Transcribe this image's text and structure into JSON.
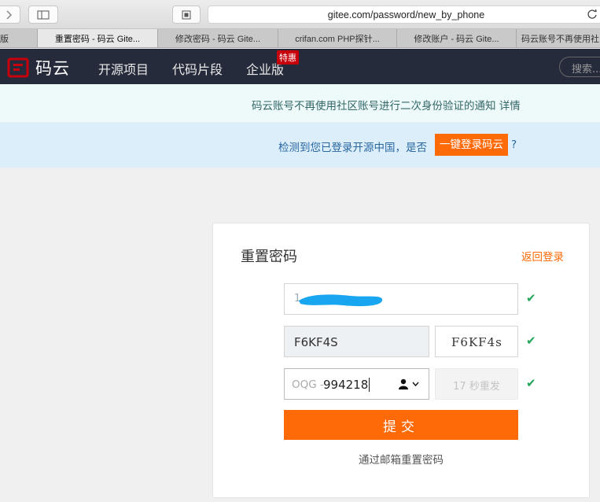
{
  "browser": {
    "url": "gitee.com/password/new_by_phone",
    "tabs": [
      {
        "label": "版"
      },
      {
        "label": "重置密码 - 码云 Gite..."
      },
      {
        "label": "修改密码 - 码云 Gite..."
      },
      {
        "label": "crifan.com PHP探针..."
      },
      {
        "label": "修改账户 - 码云 Gite..."
      },
      {
        "label": "码云账号不再使用社区"
      }
    ]
  },
  "header": {
    "logo_text": "码云",
    "nav": [
      "开源项目",
      "代码片段",
      "企业版"
    ],
    "badge": "特惠",
    "search_placeholder": "搜索..."
  },
  "notices": {
    "notice1": "码云账号不再使用社区账号进行二次身份验证的通知 详情",
    "notice2_text": "检测到您已登录开源中国，是否",
    "notice2_button": "一键登录码云",
    "notice2_q": "?"
  },
  "form": {
    "title": "重置密码",
    "back_link": "返回登录",
    "phone_partial": "1",
    "captcha_value": "F6KF4S",
    "captcha_image_text": "F6KF4s",
    "sms_prefix": "OQG -",
    "sms_code": "994218",
    "sms_button": "17 秒重发",
    "submit_label": "提交",
    "email_link": "通过邮箱重置密码"
  },
  "colors": {
    "accent": "#fe6a08",
    "header_bg": "#252b3a",
    "success": "#21a65a"
  }
}
